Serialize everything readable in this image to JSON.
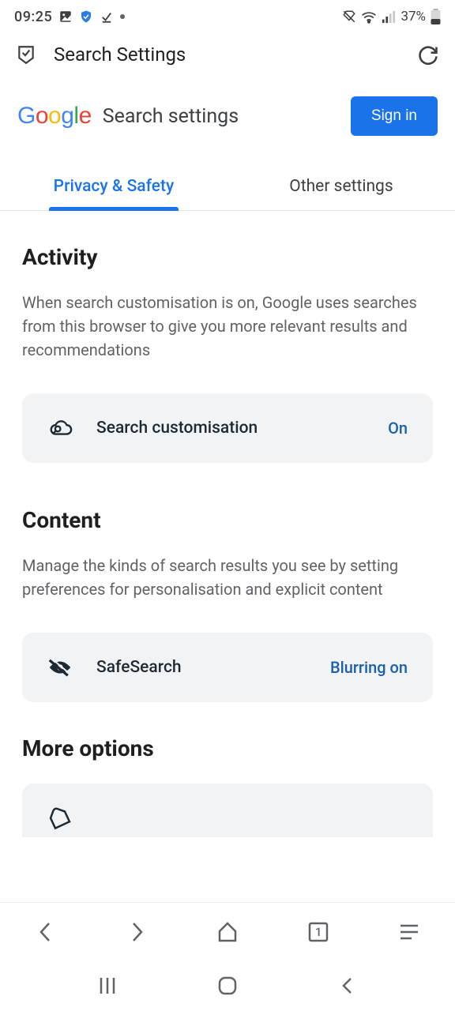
{
  "status": {
    "time": "09:25",
    "battery_text": "37%"
  },
  "appbar": {
    "title": "Search Settings"
  },
  "header": {
    "settings_title": "Search settings",
    "signin_label": "Sign in"
  },
  "tabs": {
    "privacy": "Privacy & Safety",
    "other": "Other settings"
  },
  "activity": {
    "title": "Activity",
    "desc": "When search customisation is on, Google uses searches from this browser to give you more relevant results and recommendations",
    "card_label": "Search customisation",
    "card_status": "On"
  },
  "content_section": {
    "title": "Content",
    "desc": "Manage the kinds of search results you see by setting preferences for personalisation and explicit content",
    "card_label": "SafeSearch",
    "card_status": "Blurring on"
  },
  "more": {
    "title": "More options"
  },
  "browser_nav": {
    "tab_count": "1"
  }
}
